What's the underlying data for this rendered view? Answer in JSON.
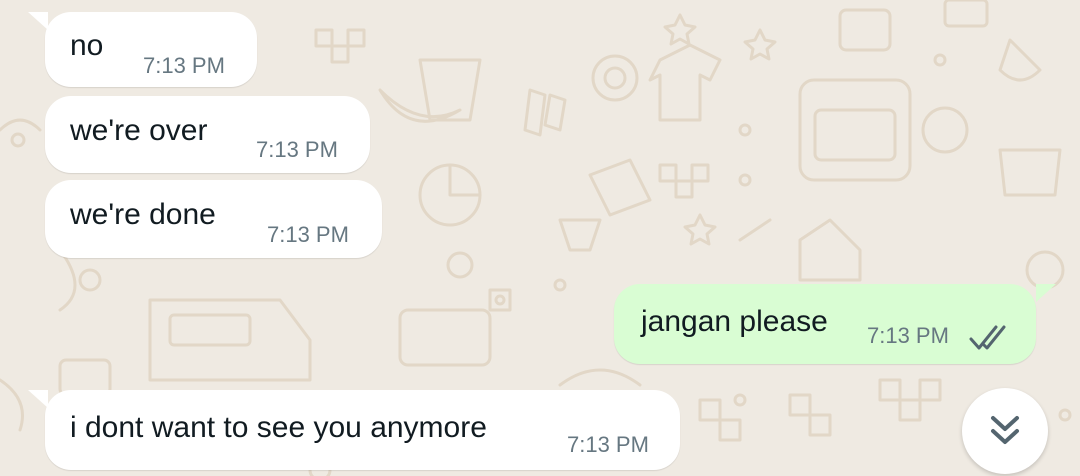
{
  "messages": [
    {
      "direction": "incoming",
      "text": "no",
      "time": "7:13 PM"
    },
    {
      "direction": "incoming",
      "text": "we're over",
      "time": "7:13 PM"
    },
    {
      "direction": "incoming",
      "text": "we're done",
      "time": "7:13 PM"
    },
    {
      "direction": "outgoing",
      "text": "jangan please",
      "time": "7:13 PM",
      "status": "sent-double-tick"
    },
    {
      "direction": "incoming",
      "text": "i dont want to see you anymore",
      "time": "7:13 PM"
    }
  ],
  "scroll_button": {
    "icon": "double-chevron-down-icon"
  },
  "colors": {
    "background": "#efeae2",
    "incoming_bubble": "#ffffff",
    "outgoing_bubble": "#d9fdd3",
    "timestamp": "#667781",
    "text": "#111b21"
  }
}
